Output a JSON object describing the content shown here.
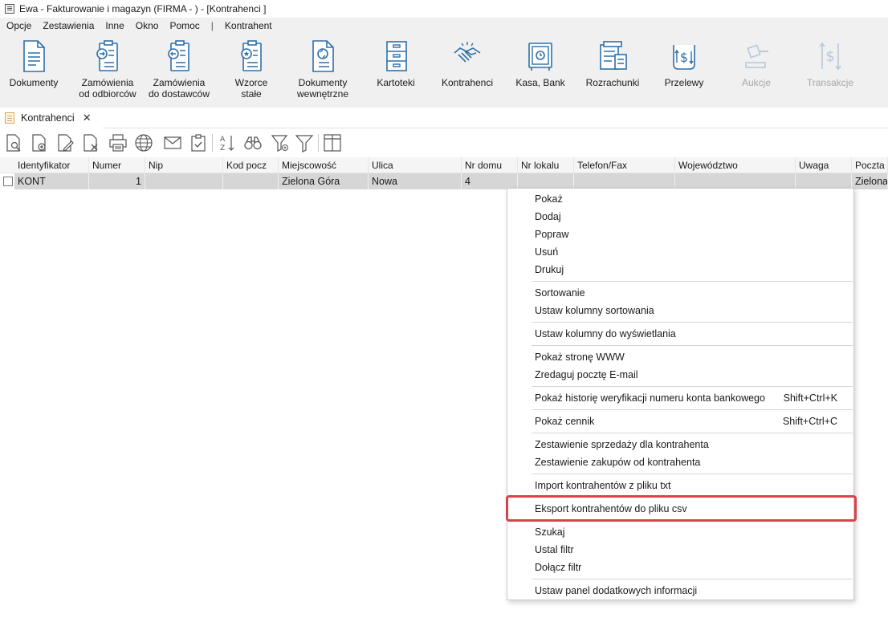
{
  "window": {
    "title": "Ewa - Fakturowanie i magazyn (FIRMA - ) - [Kontrahenci ]"
  },
  "menubar": {
    "items": [
      "Opcje",
      "Zestawienia",
      "Inne",
      "Okno",
      "Pomoc"
    ],
    "separator": "|",
    "extra": "Kontrahent"
  },
  "ribbon": {
    "buttons": [
      {
        "label": "Dokumenty",
        "icon": "document-icon",
        "enabled": true
      },
      {
        "label": "Zamówienia\nod odbiorców",
        "icon": "order-incoming-icon",
        "enabled": true
      },
      {
        "label": "Zamówienia\ndo dostawców",
        "icon": "order-outgoing-icon",
        "enabled": true
      },
      {
        "label": "Wzorce\nstałe",
        "icon": "template-icon",
        "enabled": true
      },
      {
        "label": "Dokumenty\nwewnętrzne",
        "icon": "internal-document-icon",
        "enabled": true
      },
      {
        "label": "Kartoteki",
        "icon": "filing-cabinet-icon",
        "enabled": true
      },
      {
        "label": "Kontrahenci",
        "icon": "handshake-icon",
        "enabled": true
      },
      {
        "label": "Kasa, Bank",
        "icon": "safe-icon",
        "enabled": true
      },
      {
        "label": "Rozrachunki",
        "icon": "settlements-icon",
        "enabled": true
      },
      {
        "label": "Przelewy",
        "icon": "transfer-icon",
        "enabled": true
      },
      {
        "label": "Aukcje",
        "icon": "auction-gavel-icon",
        "enabled": false
      },
      {
        "label": "Transakcje",
        "icon": "transactions-icon",
        "enabled": false
      }
    ]
  },
  "tab": {
    "label": "Kontrahenci",
    "close": "✕"
  },
  "toolbar": {
    "icons": [
      "preview-icon",
      "add-document-icon",
      "edit-document-icon",
      "delete-document-icon",
      "print-icon",
      "www-globe-icon",
      "email-icon",
      "clipboard-check-icon",
      "sort-az-icon",
      "binoculars-search-icon",
      "filter-add-icon",
      "filter-icon",
      "columns-icon"
    ]
  },
  "grid": {
    "columns": [
      "Identyfikator",
      "Numer",
      "Nip",
      "Kod pocz",
      "Miejscowość",
      "Ulica",
      "Nr domu",
      "Nr lokalu",
      "Telefon/Fax",
      "Województwo",
      "Uwaga",
      "Poczta"
    ],
    "rows": [
      [
        "KONT",
        "1",
        "",
        "",
        "Zielona Góra",
        "Nowa",
        "4",
        "",
        "",
        "",
        "",
        "Zielona"
      ]
    ]
  },
  "context_menu": {
    "groups": [
      [
        {
          "label": "Pokaż"
        },
        {
          "label": "Dodaj"
        },
        {
          "label": "Popraw"
        },
        {
          "label": "Usuń"
        },
        {
          "label": "Drukuj"
        }
      ],
      [
        {
          "label": "Sortowanie"
        },
        {
          "label": "Ustaw kolumny sortowania"
        }
      ],
      [
        {
          "label": "Ustaw kolumny do wyświetlania"
        }
      ],
      [
        {
          "label": "Pokaż stronę WWW"
        },
        {
          "label": "Zredaguj pocztę E-mail"
        }
      ],
      [
        {
          "label": "Pokaż historię weryfikacji numeru konta bankowego",
          "shortcut": "Shift+Ctrl+K"
        }
      ],
      [
        {
          "label": "Pokaż cennik",
          "shortcut": "Shift+Ctrl+C"
        }
      ],
      [
        {
          "label": "Zestawienie sprzedaży dla kontrahenta"
        },
        {
          "label": "Zestawienie zakupów od kontrahenta"
        }
      ],
      [
        {
          "label": "Import kontrahentów z pliku txt"
        }
      ],
      [
        {
          "label": "Eksport kontrahentów do pliku csv",
          "highlighted": true
        }
      ],
      [
        {
          "label": "Szukaj"
        },
        {
          "label": "Ustal filtr"
        },
        {
          "label": "Dołącz filtr"
        }
      ],
      [
        {
          "label": "Ustaw panel dodatkowych informacji"
        }
      ]
    ]
  },
  "colors": {
    "ribbon_bg": "#f0f0f0",
    "icon_blue": "#2f6fa8",
    "row_selected": "#d6d6d6",
    "highlight_border": "#d9434a",
    "disabled_text": "#a8a8a8"
  }
}
